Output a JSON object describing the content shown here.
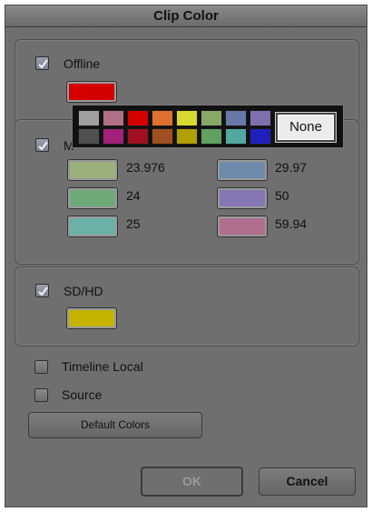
{
  "dialog": {
    "title": "Clip Color",
    "offline": {
      "label": "Offline",
      "checked": true,
      "color": "#d40000"
    },
    "middle_label_partial": "M",
    "middle_checked": true,
    "rates": [
      {
        "label": "23.976",
        "color": "#9ab07a"
      },
      {
        "label": "29.97",
        "color": "#6e8aab"
      },
      {
        "label": "24",
        "color": "#6ea97a"
      },
      {
        "label": "50",
        "color": "#8676b4"
      },
      {
        "label": "25",
        "color": "#6ab2a8"
      },
      {
        "label": "59.94",
        "color": "#b06e8e"
      }
    ],
    "sdhd": {
      "label": "SD/HD",
      "checked": true,
      "color": "#c4b400"
    },
    "timeline_local": {
      "label": "Timeline Local",
      "checked": false
    },
    "source": {
      "label": "Source",
      "checked": false
    },
    "default_colors_label": "Default Colors",
    "ok_label": "OK",
    "cancel_label": "Cancel"
  },
  "picker": {
    "top_row": [
      "#a0a0a0",
      "#b07088",
      "#d40000",
      "#e07030",
      "#d8d830",
      "#88a868",
      "#6878a8",
      "#8070b0"
    ],
    "bottom_row": [
      "#505050",
      "#a0207a",
      "#a01020",
      "#a05020",
      "#b0a000",
      "#60a060",
      "#50a8a0",
      "#2020c0"
    ],
    "none_label": "None"
  }
}
